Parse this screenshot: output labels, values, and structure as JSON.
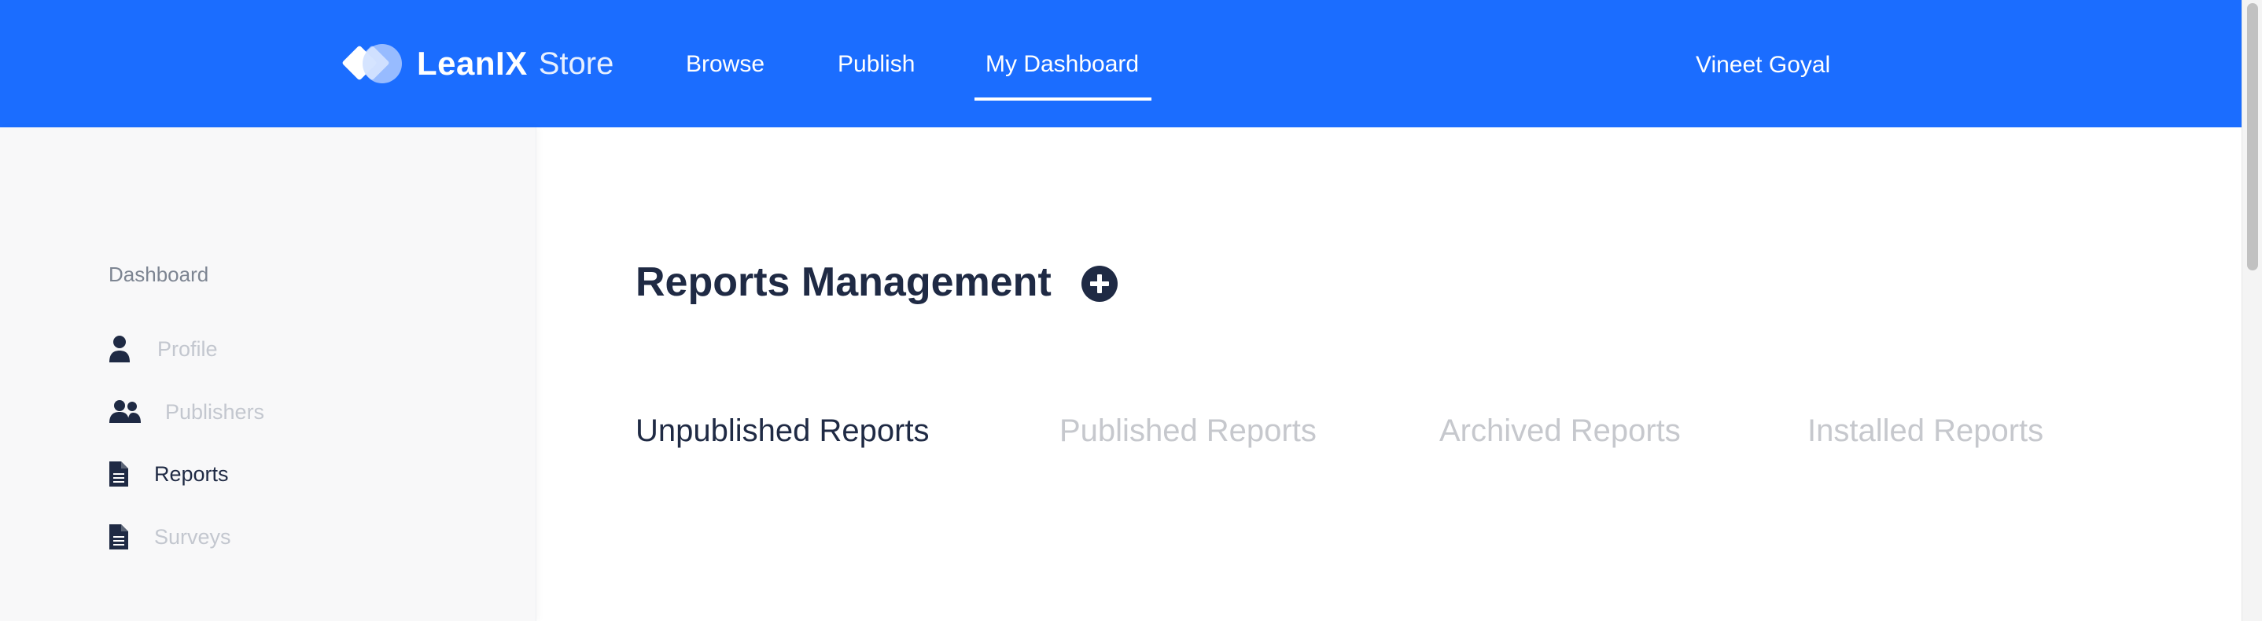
{
  "header": {
    "logo_name": "LeanIX",
    "logo_suffix": "Store",
    "nav": [
      {
        "label": "Browse"
      },
      {
        "label": "Publish"
      },
      {
        "label": "My Dashboard",
        "active": true
      }
    ],
    "user_name": "Vineet Goyal",
    "icons": {
      "logo": "leanix-logo-icon"
    }
  },
  "sidebar": {
    "heading": "Dashboard",
    "items": [
      {
        "label": "Profile",
        "icon": "user-icon"
      },
      {
        "label": "Publishers",
        "icon": "users-icon"
      },
      {
        "label": "Reports",
        "icon": "file-icon",
        "active": true
      },
      {
        "label": "Surveys",
        "icon": "file-icon"
      }
    ]
  },
  "main": {
    "title": "Reports Management",
    "add_icon": "plus-circle-icon",
    "tabs": [
      {
        "label": "Unpublished Reports",
        "active": true
      },
      {
        "label": "Published Reports"
      },
      {
        "label": "Archived Reports"
      },
      {
        "label": "Installed Reports"
      }
    ]
  },
  "colors": {
    "header_bg": "#1b6dff",
    "text_dark": "#1f2a44",
    "text_muted": "#c6c8cd",
    "sidebar_bg": "#f8f8f9"
  }
}
